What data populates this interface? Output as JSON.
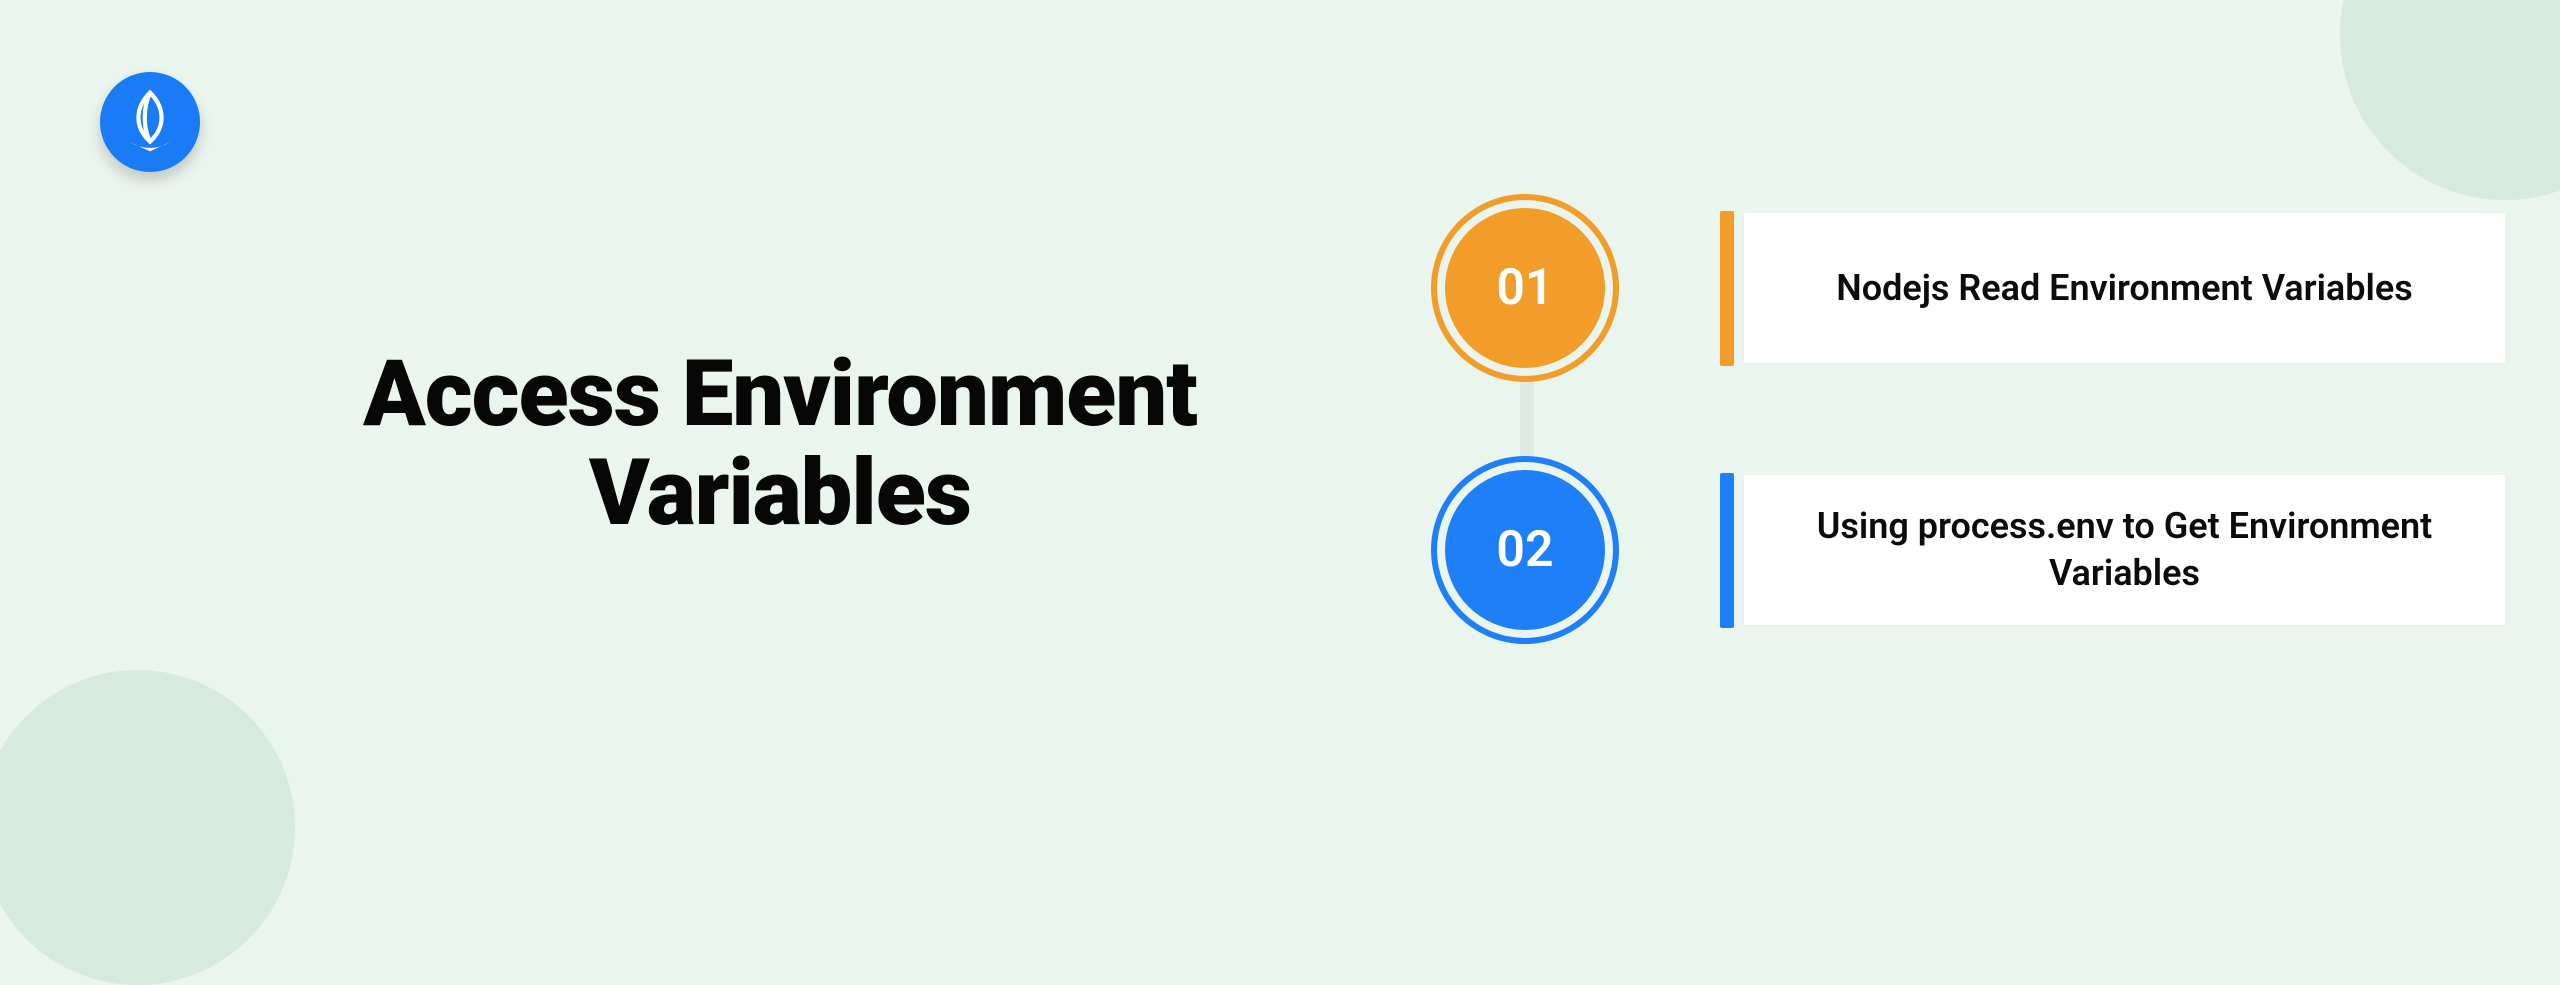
{
  "title_line1": "Access Environment",
  "title_line2": "Variables",
  "steps": [
    {
      "num": "01",
      "label": "Nodejs Read Environment Variables",
      "color": "orange"
    },
    {
      "num": "02",
      "label": "Using process.env to Get Environment Variables",
      "color": "blue"
    }
  ]
}
